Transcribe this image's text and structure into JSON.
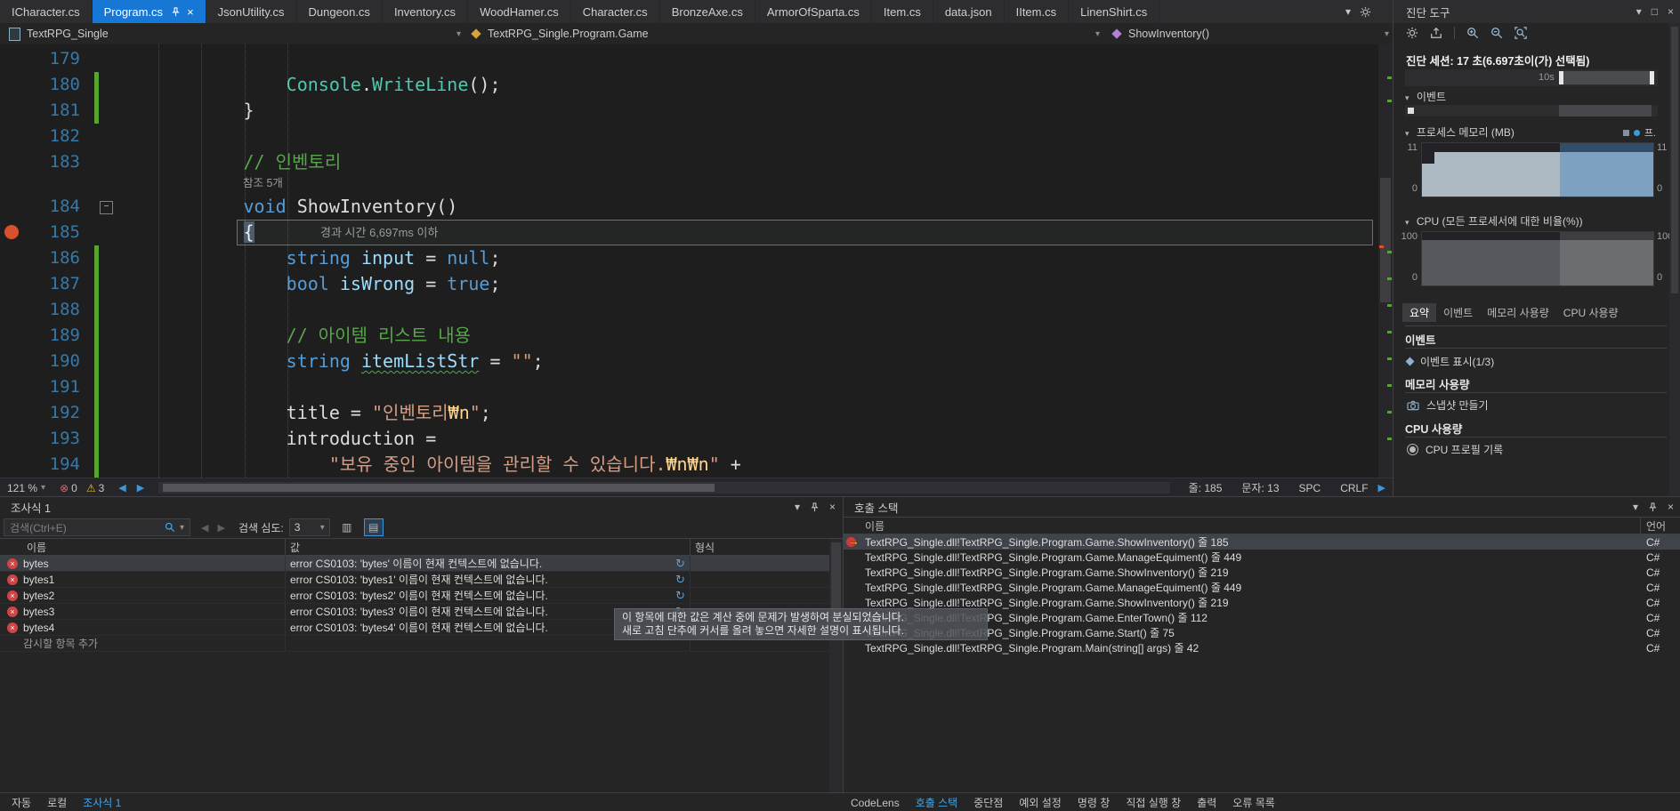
{
  "colors": {
    "accent": "#1678d4",
    "breakpoint": "#d8512c",
    "error": "#cf4545",
    "warning": "#e5c532",
    "link": "#4ba3e3",
    "comment": "#57a64a",
    "keyword": "#569cd6",
    "type": "#4ec9b0",
    "string": "#d69d85",
    "escape": "#ffd68f",
    "line_number": "#3579a8",
    "change_bar": "#55a630"
  },
  "icons": {
    "close": "×",
    "chevron_down": "▾",
    "back": "◀",
    "forward": "▶",
    "error_circle": "⊗",
    "warning": "⚠",
    "refresh": "↻",
    "minus": "−",
    "arrow_right": "→",
    "grid1": "▥",
    "grid2": "▤",
    "expander": "▾",
    "scroll_right": "▶",
    "square": "□"
  },
  "tab_bar": {
    "tabs": [
      {
        "label": "ICharacter.cs",
        "active": false
      },
      {
        "label": "Program.cs",
        "active": true
      },
      {
        "label": "JsonUtility.cs",
        "active": false
      },
      {
        "label": "Dungeon.cs",
        "active": false
      },
      {
        "label": "Inventory.cs",
        "active": false
      },
      {
        "label": "WoodHamer.cs",
        "active": false
      },
      {
        "label": "Character.cs",
        "active": false
      },
      {
        "label": "BronzeAxe.cs",
        "active": false
      },
      {
        "label": "ArmorOfSparta.cs",
        "active": false
      },
      {
        "label": "Item.cs",
        "active": false
      },
      {
        "label": "data.json",
        "active": false
      },
      {
        "label": "IItem.cs",
        "active": false
      },
      {
        "label": "LinenShirt.cs",
        "active": false
      }
    ]
  },
  "nav_bar": {
    "project": "TextRPG_Single",
    "type": "TextRPG_Single.Program.Game",
    "member": "ShowInventory()"
  },
  "editor": {
    "perf_tip": "경과 시간 6,697ms 이하",
    "lines": [
      {
        "num": "179",
        "segs": []
      },
      {
        "num": "180",
        "changed": true,
        "segs": [
          {
            "t": "                ",
            "c": "pl"
          },
          {
            "t": "Console",
            "c": "ty"
          },
          {
            "t": ".",
            "c": "pl"
          },
          {
            "t": "WriteLine",
            "c": "ty"
          },
          {
            "t": "();",
            "c": "pl"
          }
        ]
      },
      {
        "num": "181",
        "changed": true,
        "segs": [
          {
            "t": "            }",
            "c": "pl"
          }
        ]
      },
      {
        "num": "182",
        "segs": []
      },
      {
        "num": "183",
        "code_lens": "참조 5개",
        "segs": [
          {
            "t": "            ",
            "c": "pl"
          },
          {
            "t": "// 인벤토리",
            "c": "com"
          }
        ]
      },
      {
        "num": "184",
        "collapse": true,
        "segs": [
          {
            "t": "            ",
            "c": "pl"
          },
          {
            "t": "void",
            "c": "kw"
          },
          {
            "t": " ShowInventory()",
            "c": "pl"
          }
        ]
      },
      {
        "num": "185",
        "current": true,
        "breakpoint": true,
        "segs": [
          {
            "t": "            ",
            "c": "pl"
          },
          {
            "t": "{",
            "c": "cur"
          }
        ]
      },
      {
        "num": "186",
        "changed": true,
        "segs": [
          {
            "t": "                ",
            "c": "pl"
          },
          {
            "t": "string",
            "c": "kw"
          },
          {
            "t": " ",
            "c": "pl"
          },
          {
            "t": "input",
            "c": "loc"
          },
          {
            "t": " = ",
            "c": "pl"
          },
          {
            "t": "null",
            "c": "kw"
          },
          {
            "t": ";",
            "c": "pl"
          }
        ]
      },
      {
        "num": "187",
        "changed": true,
        "segs": [
          {
            "t": "                ",
            "c": "pl"
          },
          {
            "t": "bool",
            "c": "kw"
          },
          {
            "t": " ",
            "c": "pl"
          },
          {
            "t": "isWrong",
            "c": "loc"
          },
          {
            "t": " = ",
            "c": "pl"
          },
          {
            "t": "true",
            "c": "kw"
          },
          {
            "t": ";",
            "c": "pl"
          }
        ]
      },
      {
        "num": "188",
        "changed": true,
        "segs": []
      },
      {
        "num": "189",
        "changed": true,
        "segs": [
          {
            "t": "                ",
            "c": "pl"
          },
          {
            "t": "// 아이템 리스트 내용",
            "c": "com"
          }
        ]
      },
      {
        "num": "190",
        "changed": true,
        "segs": [
          {
            "t": "                ",
            "c": "pl"
          },
          {
            "t": "string",
            "c": "kw"
          },
          {
            "t": " ",
            "c": "pl"
          },
          {
            "t": "itemListStr",
            "c": "loc sq"
          },
          {
            "t": " = ",
            "c": "pl"
          },
          {
            "t": "\"\"",
            "c": "str"
          },
          {
            "t": ";",
            "c": "pl"
          }
        ]
      },
      {
        "num": "191",
        "changed": true,
        "segs": []
      },
      {
        "num": "192",
        "changed": true,
        "segs": [
          {
            "t": "                ",
            "c": "pl"
          },
          {
            "t": "title",
            "c": "pl"
          },
          {
            "t": " = ",
            "c": "pl"
          },
          {
            "t": "\"인벤토리",
            "c": "str"
          },
          {
            "t": "₩n",
            "c": "esc"
          },
          {
            "t": "\"",
            "c": "str"
          },
          {
            "t": ";",
            "c": "pl"
          }
        ]
      },
      {
        "num": "193",
        "changed": true,
        "segs": [
          {
            "t": "                ",
            "c": "pl"
          },
          {
            "t": "introduction",
            "c": "pl"
          },
          {
            "t": " =",
            "c": "pl"
          }
        ]
      },
      {
        "num": "194",
        "changed": true,
        "segs": [
          {
            "t": "                    ",
            "c": "pl"
          },
          {
            "t": "\"보유 중인 아이템을 관리할 수 있습니다.",
            "c": "str"
          },
          {
            "t": "₩n₩n",
            "c": "esc"
          },
          {
            "t": "\" ",
            "c": "str"
          },
          {
            "t": "+",
            "c": "pl"
          }
        ]
      }
    ]
  },
  "status_bar": {
    "zoom": "121 %",
    "error_count": "0",
    "warning_count": "3",
    "line": "줄: 185",
    "column": "문자: 13",
    "insert_mode": "SPC",
    "eol": "CRLF"
  },
  "watch": {
    "title": "조사식 1",
    "search_placeholder": "검색(Ctrl+E)",
    "depth_label": "검색 심도:",
    "depth_value": "3",
    "columns": [
      "이름",
      "값",
      "형식"
    ],
    "rows": [
      {
        "name": "bytes",
        "value": "error CS0103: 'bytes' 이름이 현재 컨텍스트에 없습니다.",
        "selected": true
      },
      {
        "name": "bytes1",
        "value": "error CS0103: 'bytes1' 이름이 현재 컨텍스트에 없습니다.",
        "selected": false
      },
      {
        "name": "bytes2",
        "value": "error CS0103: 'bytes2' 이름이 현재 컨텍스트에 없습니다.",
        "selected": false
      },
      {
        "name": "bytes3",
        "value": "error CS0103: 'bytes3' 이름이 현재 컨텍스트에 없습니다.",
        "selected": false
      },
      {
        "name": "bytes4",
        "value": "error CS0103: 'bytes4' 이름이 현재 컨텍스트에 없습니다.",
        "selected": false
      }
    ],
    "add_row_label": "감시할 항목 추가"
  },
  "call_stack": {
    "title": "호출 스택",
    "columns": [
      "이름",
      "언어"
    ],
    "frames": [
      {
        "name": "TextRPG_Single.dll!TextRPG_Single.Program.Game.ShowInventory() 줄 185",
        "lang": "C#",
        "current": true
      },
      {
        "name": "TextRPG_Single.dll!TextRPG_Single.Program.Game.ManageEquiment() 줄 449",
        "lang": "C#",
        "current": false
      },
      {
        "name": "TextRPG_Single.dll!TextRPG_Single.Program.Game.ShowInventory() 줄 219",
        "lang": "C#",
        "current": false
      },
      {
        "name": "TextRPG_Single.dll!TextRPG_Single.Program.Game.ManageEquiment() 줄 449",
        "lang": "C#",
        "current": false
      },
      {
        "name": "TextRPG_Single.dll!TextRPG_Single.Program.Game.ShowInventory() 줄 219",
        "lang": "C#",
        "current": false
      },
      {
        "name": "TextRPG_Single.dll!TextRPG_Single.Program.Game.EnterTown() 줄 112",
        "lang": "C#",
        "current": false
      },
      {
        "name": "TextRPG_Single.dll!TextRPG_Single.Program.Game.Start() 줄 75",
        "lang": "C#",
        "current": false
      },
      {
        "name": "TextRPG_Single.dll!TextRPG_Single.Program.Main(string[] args) 줄 42",
        "lang": "C#",
        "current": false
      }
    ]
  },
  "tooltip": {
    "line1": "이 항목에 대한 값은 계산 중에 문제가 발생하여 분실되었습니다.",
    "line2": "새로 고침 단추에 커서를 올려 놓으면 자세한 설명이 표시됩니다."
  },
  "bottom_tabs": {
    "left": [
      {
        "label": "자동",
        "active": false
      },
      {
        "label": "로컬",
        "active": false
      },
      {
        "label": "조사식 1",
        "active": true
      }
    ],
    "right": [
      {
        "label": "CodeLens",
        "active": false
      },
      {
        "label": "호출 스택",
        "active": true
      },
      {
        "label": "중단점",
        "active": false
      },
      {
        "label": "예외 설정",
        "active": false
      },
      {
        "label": "명령 창",
        "active": false
      },
      {
        "label": "직접 실행 창",
        "active": false
      },
      {
        "label": "출력",
        "active": false
      },
      {
        "label": "오류 목록",
        "active": false
      }
    ]
  },
  "diag": {
    "title": "진단 도구",
    "session": "진단 세션: 17 초(6.697초이(가) 선택됨)",
    "timeline_label": "10s",
    "events_section": "이벤트",
    "memory_section": "프로세스 메모리 (MB)",
    "cpu_section": "CPU (모든 프로세서에 대한 비율(%))",
    "legend_label": "프.",
    "memory_axis": {
      "max": "11",
      "min": "0"
    },
    "cpu_axis": {
      "max": "100",
      "min": "0"
    },
    "tabs": [
      {
        "label": "요약",
        "active": true
      },
      {
        "label": "이벤트",
        "active": false
      },
      {
        "label": "메모리 사용량",
        "active": false
      },
      {
        "label": "CPU 사용량",
        "active": false
      }
    ],
    "summary": {
      "events_header": "이벤트",
      "events_link": "이벤트 표시(1/3)",
      "memory_header": "메모리 사용량",
      "memory_link": "스냅샷 만들기",
      "cpu_header": "CPU 사용량",
      "cpu_link": "CPU 프로필 기록"
    }
  }
}
